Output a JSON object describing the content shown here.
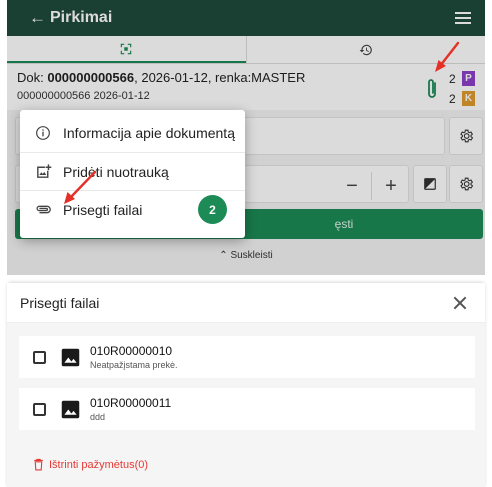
{
  "header": {
    "back_label": "Pirkimai"
  },
  "tabs": [
    {
      "icon": "qr-scan-icon"
    },
    {
      "icon": "history-icon"
    }
  ],
  "document": {
    "prefix": "Dok: ",
    "number": "000000000566",
    "rest": ", 2026-01-12, renka:MASTER",
    "subline": "000000000566 2026-01-12"
  },
  "badges": [
    {
      "count": "2",
      "letter": "P",
      "color": "#8e3fc9"
    },
    {
      "count": "2",
      "letter": "K",
      "color": "#e09b2d"
    }
  ],
  "action_button": {
    "visible_text": "ęsti"
  },
  "collapse_label": "Suskleisti",
  "context_menu": {
    "items": [
      {
        "label": "Informacija apie dokumentą",
        "icon": "info-icon"
      },
      {
        "label": "Pridėti nuotrauką",
        "icon": "add-photo-icon"
      },
      {
        "label": "Prisegti failai",
        "icon": "paperclip-icon",
        "count": "2"
      }
    ]
  },
  "dialog": {
    "title": "Prisegti failai",
    "files": [
      {
        "name": "010R00000010",
        "description": "Neatpažįstama prekė."
      },
      {
        "name": "010R00000011",
        "description": "ddd"
      }
    ],
    "delete_label": "Ištrinti pažymėtus(0)"
  },
  "colors": {
    "brand_dark": "#1f4a3c",
    "accent_green": "#1c8b56",
    "danger": "#e53935",
    "annotation_red": "#e53027"
  }
}
